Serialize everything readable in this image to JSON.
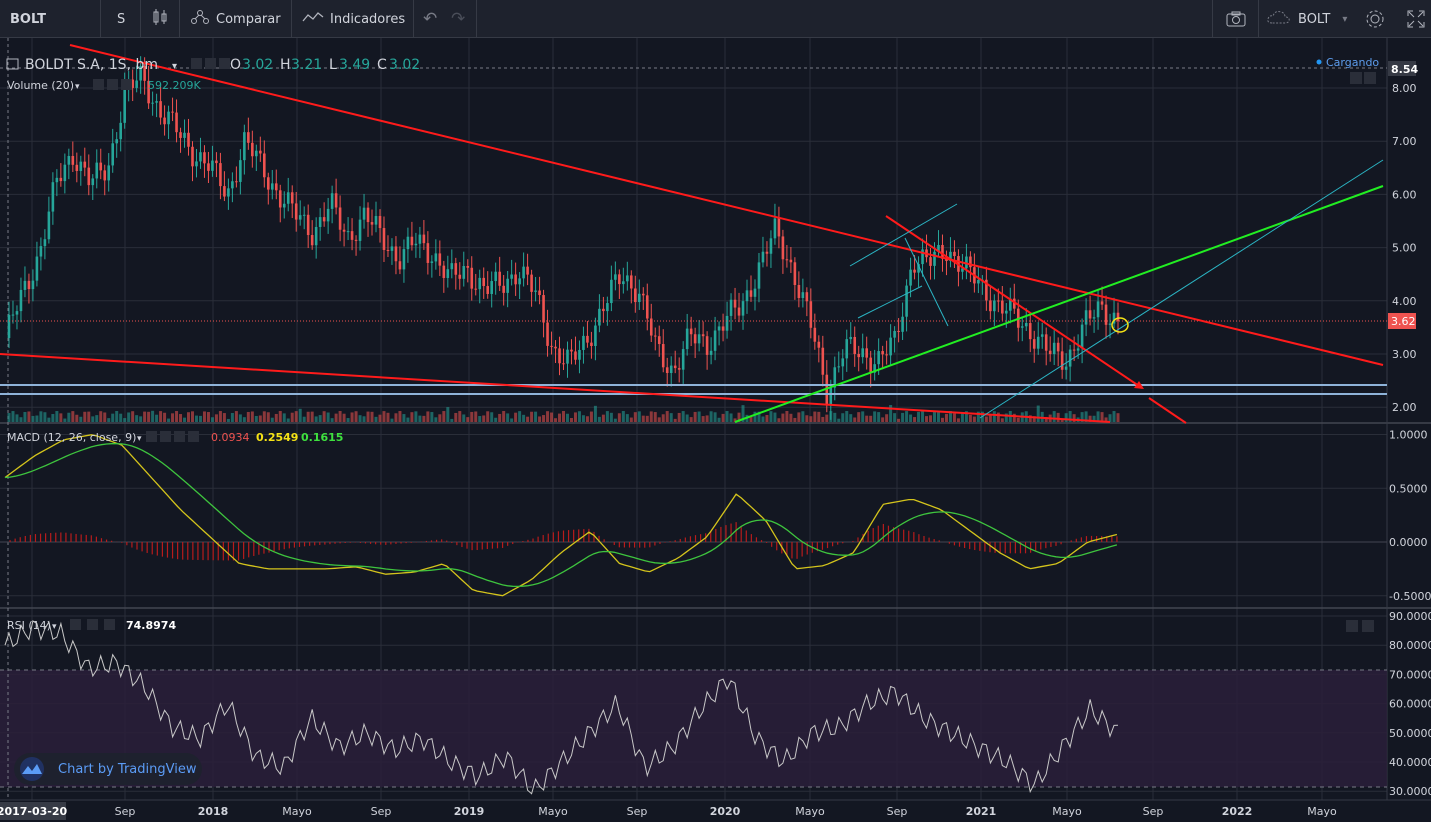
{
  "toolbar": {
    "symbol": "BOLT",
    "interval": "S",
    "compare_label": "Comparar",
    "indicators_label": "Indicadores",
    "right_symbol": "BOLT"
  },
  "legend": {
    "title": "BOLDT S.A, 1S, bm",
    "o_label": "O",
    "o_value": "3.02",
    "h_label": "H",
    "h_value": "3.21",
    "l_label": "L",
    "l_value": "3.49",
    "c_label": "C",
    "c_value": "3.02",
    "volume_label": "Volume (20)",
    "volume_value": "592.209K",
    "loading": "Cargando"
  },
  "macd_legend": {
    "label": "MACD (12, 26, close, 9)",
    "v1": "0.0934",
    "v2": "0.2549",
    "v3": "0.1615"
  },
  "rsi_legend": {
    "label": "RSI (14)",
    "value": "74.8974"
  },
  "watermark": "Chart by TradingView",
  "colors": {
    "up": "#26a69a",
    "down": "#ef5350",
    "trend_red": "#ff1b1b",
    "trend_green": "#22ee22",
    "support": "#8fb3d9",
    "macd_line": "#d4c41c",
    "signal_line": "#3ec43e",
    "rsi_line": "#c8c8c8",
    "rsi_band": "#2a1f3a"
  },
  "chart_data": [
    {
      "type": "candlestick",
      "title": "BOLDT S.A, 1S, bm",
      "ylim": [
        1.8,
        8.6
      ],
      "price_ticks": [
        "8.00",
        "7.00",
        "6.00",
        "5.00",
        "4.00",
        "3.00",
        "2.00"
      ],
      "last_price": "3.62",
      "high_price_label": "8.54",
      "x_labels": [
        "2017-03-20",
        "Sep",
        "2018",
        "Mayo",
        "Sep",
        "2019",
        "Mayo",
        "Sep",
        "2020",
        "Mayo",
        "Sep",
        "2021",
        "Mayo",
        "Sep",
        "2022",
        "Mayo"
      ],
      "close_series": [
        3.3,
        4.1,
        4.9,
        6.2,
        6.8,
        6.2,
        6.5,
        7.9,
        8.2,
        7.6,
        7.2,
        6.8,
        6.5,
        6.0,
        7.0,
        6.5,
        6.0,
        5.6,
        5.3,
        5.8,
        5.2,
        5.6,
        5.2,
        4.8,
        5.1,
        4.9,
        4.4,
        4.6,
        4.2,
        4.3,
        4.6,
        4.1,
        3.1,
        2.8,
        3.3,
        3.9,
        4.5,
        4.2,
        3.1,
        2.7,
        3.3,
        3.2,
        3.6,
        3.9,
        4.6,
        5.3,
        4.6,
        3.6,
        2.3,
        3.1,
        3.0,
        2.9,
        3.2,
        4.8,
        4.7,
        5.0,
        4.6,
        4.3,
        3.9,
        3.7,
        3.4,
        3.0,
        2.9,
        3.5,
        3.9,
        3.62
      ],
      "volume_ticks": [
        "592.209K"
      ]
    },
    {
      "type": "line",
      "name": "MACD (12, 26, close, 9)",
      "ylim": [
        -0.55,
        1.05
      ],
      "y_ticks": [
        "1.0000",
        "0.5000",
        "0.0000",
        "-0.5000"
      ],
      "values": [
        0.6,
        0.8,
        0.95,
        1.0,
        0.9,
        0.6,
        0.3,
        0.05,
        -0.2,
        -0.25,
        -0.25,
        -0.25,
        -0.23,
        -0.3,
        -0.28,
        -0.2,
        -0.45,
        -0.5,
        -0.35,
        -0.1,
        0.1,
        -0.2,
        -0.28,
        -0.15,
        0.05,
        0.45,
        0.2,
        -0.25,
        -0.22,
        -0.1,
        0.35,
        0.4,
        0.3,
        0.1,
        -0.1,
        -0.25,
        -0.2,
        0.0,
        0.07
      ]
    },
    {
      "type": "line",
      "name": "RSI (14)",
      "ylim": [
        28,
        92
      ],
      "y_ticks": [
        "90.0000",
        "80.0000",
        "70.0000",
        "60.0000",
        "50.0000",
        "40.0000",
        "30.0000"
      ],
      "band": [
        30,
        70
      ],
      "values": [
        80,
        86,
        84,
        72,
        74,
        66,
        52,
        48,
        60,
        42,
        38,
        55,
        45,
        50,
        44,
        48,
        40,
        35,
        42,
        30,
        40,
        50,
        60,
        38,
        45,
        58,
        69,
        48,
        40,
        50,
        52,
        60,
        64,
        55,
        50,
        45,
        40,
        32,
        45,
        58,
        50
      ]
    }
  ]
}
